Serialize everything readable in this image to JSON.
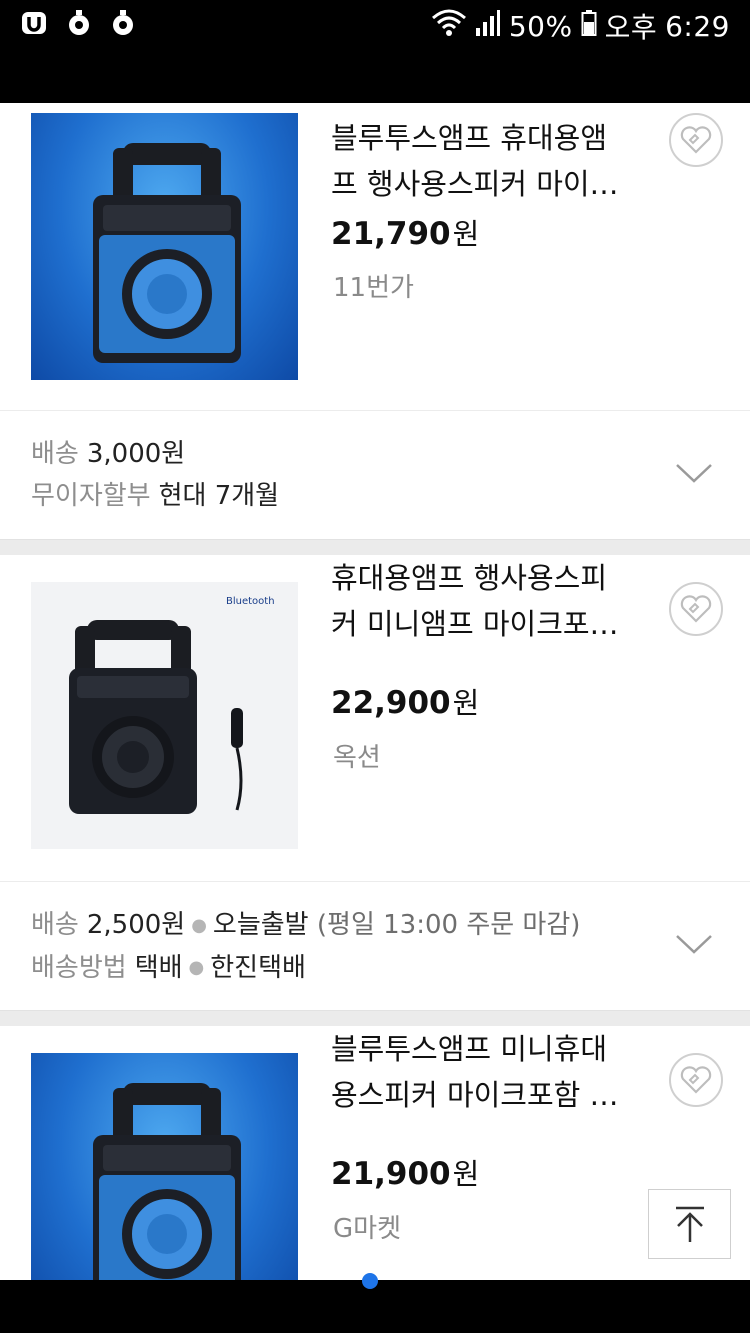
{
  "status": {
    "battery_percent": "50%",
    "ampm": "오후",
    "time": "6:29",
    "icons": [
      "app-u-icon",
      "notification-icon",
      "notification-icon",
      "wifi-icon",
      "signal-icon",
      "battery-icon"
    ]
  },
  "products": [
    {
      "title_line1": "블루투스앰프 휴대용앰",
      "title_line2": "프 행사용스피커 마이…",
      "price": "21,790",
      "currency": "원",
      "seller": "11번가",
      "shipping": {
        "line1_label": "배송",
        "line1_value": "3,000원",
        "line2_label": "무이자할부",
        "line2_value": "현대 7개월"
      }
    },
    {
      "title_line1": "휴대용앰프 행사용스피",
      "title_line2": "커 미니앰프 마이크포…",
      "price": "22,900",
      "currency": "원",
      "seller": "옥션",
      "image_text": "Bluetooth",
      "shipping": {
        "line1_label": "배송",
        "line1_value": "2,500원",
        "line1_extra": "오늘출발",
        "line1_note": "(평일 13:00 주문 마감)",
        "line2_label": "배송방법",
        "line2_value": "택배",
        "line2_extra": "한진택배"
      }
    },
    {
      "title_line1": "블루투스앰프 미니휴대",
      "title_line2": "용스피커 마이크포함 …",
      "price": "21,900",
      "currency": "원",
      "seller": "G마켓"
    }
  ],
  "colors": {
    "accent": "#1e74e8",
    "price_text": "#111111",
    "muted_text": "#8a8a8a"
  }
}
